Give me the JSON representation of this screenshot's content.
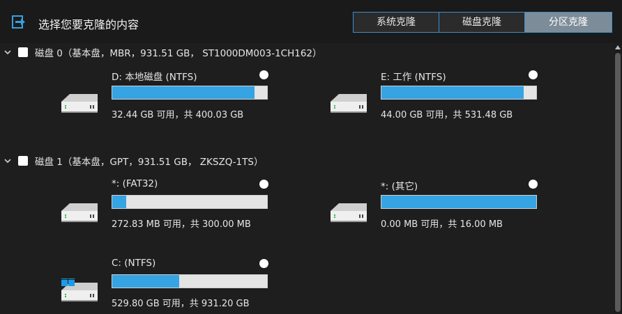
{
  "header": {
    "title": "选择您要克隆的内容",
    "modes": [
      {
        "label": "系统克隆",
        "active": false
      },
      {
        "label": "磁盘克隆",
        "active": false
      },
      {
        "label": "分区克隆",
        "active": true
      }
    ]
  },
  "disks": [
    {
      "label": "磁盘 0（基本盘，MBR，931.51 GB， ST1000DM003-1CH162）",
      "partitions": [
        {
          "name": "D: 本地磁盘 (NTFS)",
          "usage": "32.44 GB 可用，共 400.03 GB",
          "used_fraction": 0.919,
          "icon": "hdd-icon"
        },
        {
          "name": "E: 工作 (NTFS)",
          "usage": "44.00 GB 可用，共 531.48 GB",
          "used_fraction": 0.917,
          "icon": "hdd-icon"
        }
      ]
    },
    {
      "label": "磁盘 1（基本盘，GPT，931.51 GB， ZKSZQ-1TS）",
      "partitions": [
        {
          "name": "*: (FAT32)",
          "usage": "272.83 MB 可用，共 300.00 MB",
          "used_fraction": 0.091,
          "icon": "hdd-icon"
        },
        {
          "name": "*: (其它)",
          "usage": "0.00 MB 可用，共 16.00 MB",
          "used_fraction": 1.0,
          "icon": "hdd-icon"
        },
        {
          "name": "C: (NTFS)",
          "usage": "529.80 GB 可用，共 931.20 GB",
          "used_fraction": 0.431,
          "icon": "windows-hdd-icon"
        }
      ]
    }
  ],
  "colors": {
    "accent": "#36a3e2",
    "active_mode": "#7d8c99",
    "border": "#3a8fd0"
  }
}
